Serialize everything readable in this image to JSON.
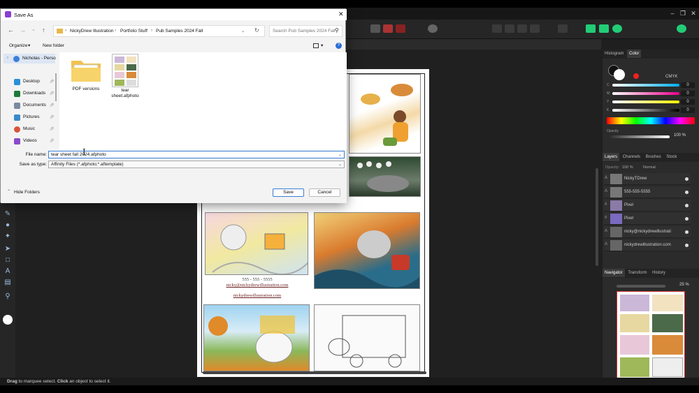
{
  "dialog": {
    "title": "Save As",
    "breadcrumb": [
      "NickyDrew Illustration",
      "Portfolio Stuff",
      "Pub Samples 2024 Fall"
    ],
    "search_placeholder": "Search Pub Samples 2024 Fall",
    "organize_label": "Organize",
    "new_folder_label": "New folder",
    "nav_items": [
      {
        "label": "Nicholas - Perso",
        "icon": "cloud-icon"
      },
      {
        "label": "Desktop",
        "icon": "desktop-icon"
      },
      {
        "label": "Downloads",
        "icon": "downloads-icon"
      },
      {
        "label": "Documents",
        "icon": "documents-icon"
      },
      {
        "label": "Pictures",
        "icon": "pictures-icon"
      },
      {
        "label": "Music",
        "icon": "music-icon"
      },
      {
        "label": "Videos",
        "icon": "videos-icon"
      }
    ],
    "files": [
      {
        "name": "PDF versions",
        "type": "folder"
      },
      {
        "name": "tear sheet.afphoto",
        "type": "file"
      }
    ],
    "file_name_label": "File name:",
    "file_name_value": "tear sheet fall 2024.afphoto",
    "save_type_label": "Save as type:",
    "save_type_value": "Affinity Files (*.afphoto;*.aftemplate)",
    "hide_folders_label": "Hide Folders",
    "save_label": "Save",
    "cancel_label": "Cancel"
  },
  "document": {
    "phone": "555 - 555 - 5555",
    "email": "nicky@nickydrewillustration.com",
    "website": "nickydrewillustration.com"
  },
  "panels": {
    "color_tabs": [
      "Histogram",
      "Color"
    ],
    "color_model": "CMYK",
    "cmyk_labels": [
      "C",
      "M",
      "Y",
      "K"
    ],
    "cmyk_values": [
      "0",
      "0",
      "0",
      "0"
    ],
    "opacity_label": "Opacity",
    "opacity_value": "100 %",
    "layer_tabs": [
      "Layers",
      "Channels",
      "Brushes",
      "Stock"
    ],
    "layer_opacity_label": "Opacity:",
    "layer_opacity_value": "100 %",
    "blend_mode": "Normal",
    "layers": [
      {
        "kind": "A",
        "name": "NickyTDrew"
      },
      {
        "kind": "A",
        "name": "555-555-5555"
      },
      {
        "kind": "#",
        "name": "Pixel"
      },
      {
        "kind": "#",
        "name": "Pixel"
      },
      {
        "kind": "A",
        "name": "nicky@nickydrewillustrati"
      },
      {
        "kind": "A",
        "name": "nickydrewillustration.com"
      }
    ],
    "nav_tabs": [
      "Navigator",
      "Transform",
      "History"
    ],
    "zoom_value": "25 %"
  },
  "status": {
    "bold1": "Drag",
    "text1": " to marquee select. ",
    "bold2": "Click",
    "text2": " an object to select it."
  },
  "colors": {
    "accent": "#3b7fd8",
    "dialog_bg": "#f3f3f3",
    "app_bg": "#1f1f1f",
    "link": "#6b1e1e"
  }
}
